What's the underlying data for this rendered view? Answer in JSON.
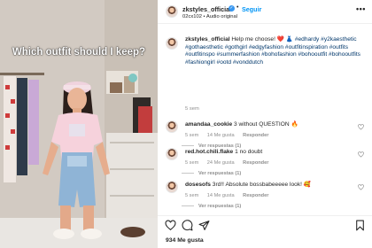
{
  "video": {
    "overlay_text": "Which outfit should I keep?"
  },
  "header": {
    "username": "zkstyles_official",
    "verified_mark": "✓",
    "separator": "•",
    "follow_label": "Seguir",
    "subtitle": "02cx102 • Audio original",
    "more_label": "•••"
  },
  "caption": {
    "username": "zkstyles_official",
    "text": "Help me choose! ❤️ 👗",
    "hashtags": "#edhardy #y2kaesthetic #gothaesthetic #gothgirl #edgyfashion #outfitinspiration #outfits #outfitinspo #summerfashion #bohofashion #bohooutfit #bohooutfits #fashiongirl #ootd #vonddutch",
    "time": "5 sem"
  },
  "comments": [
    {
      "username": "amandaa_cookie",
      "text": "3 without QUESTION 🔥",
      "time": "5 sem",
      "likes": "14 Me gusta",
      "reply_label": "Responder",
      "replies_label": "Ver respuestas (1)"
    },
    {
      "username": "red.hot.chili.flake",
      "text": "1 no doubt",
      "time": "5 sem",
      "likes": "24 Me gusta",
      "reply_label": "Responder",
      "replies_label": "Ver respuestas (1)"
    },
    {
      "username": "dosesofs",
      "text": "3rd!! Absolute bossbabeeeee look! 🥰",
      "time": "5 sem",
      "likes": "14 Me gusta",
      "reply_label": "Responder",
      "replies_label": "Ver respuestas (1)"
    }
  ],
  "actions": {
    "like_icon": "heart-icon",
    "comment_icon": "comment-icon",
    "share_icon": "share-icon",
    "save_icon": "bookmark-icon"
  },
  "likes_count": "934 Me gusta",
  "colors": {
    "link_blue": "#0095f6",
    "hashtag_blue": "#00376b",
    "verified_blue": "#3897f0",
    "muted_gray": "#8e8e8e"
  }
}
